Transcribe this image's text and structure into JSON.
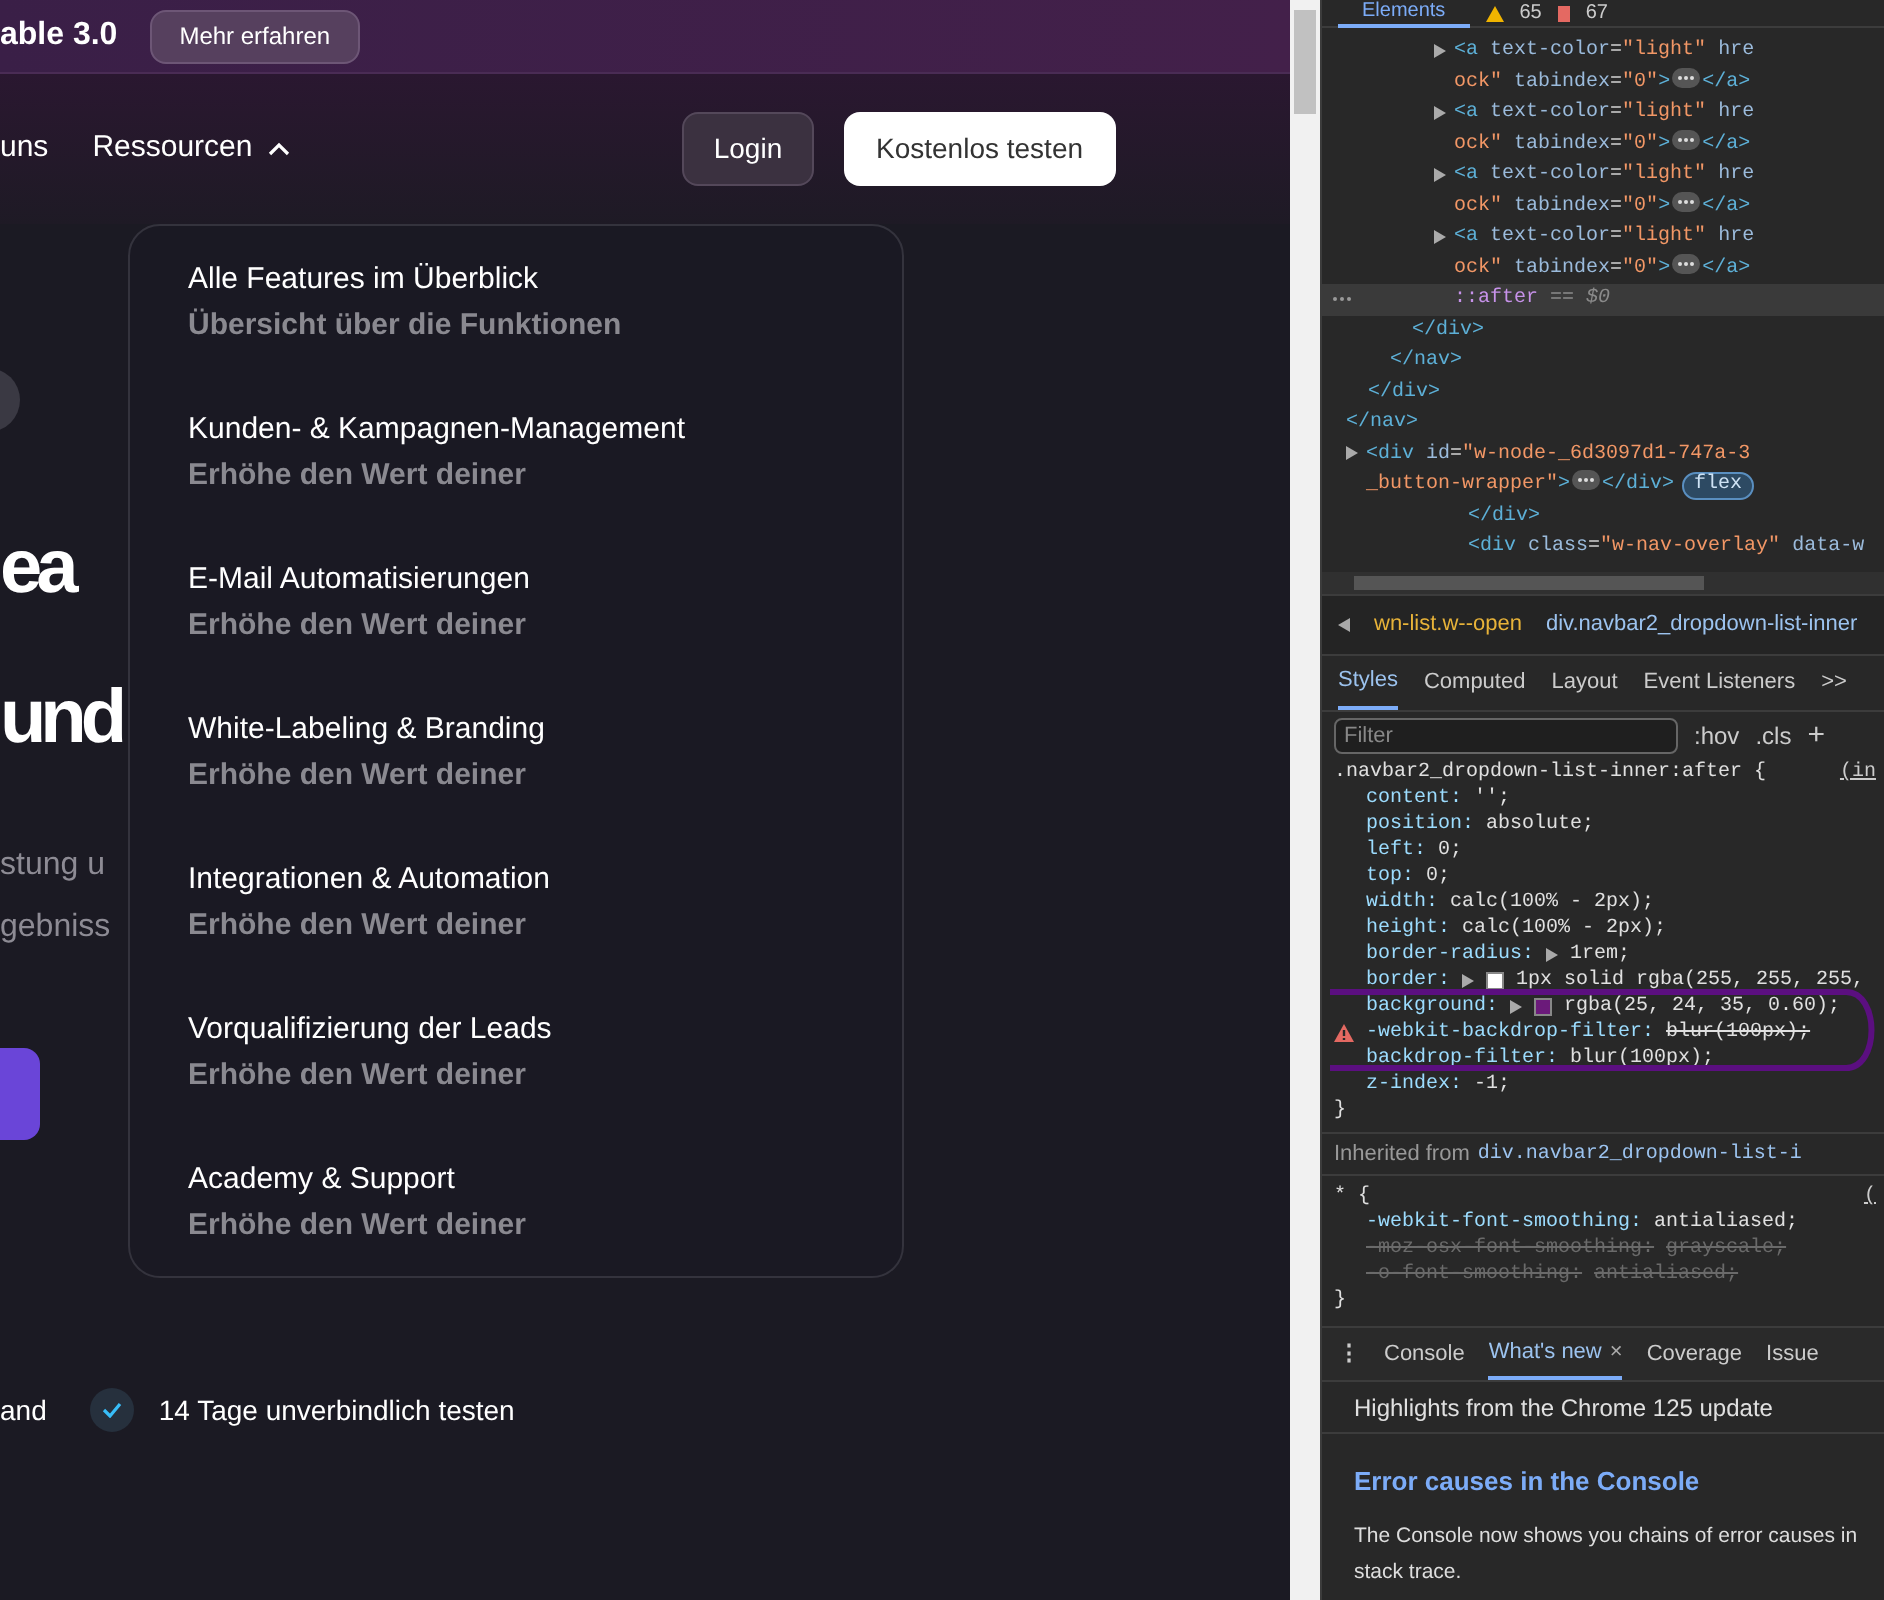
{
  "site": {
    "banner": {
      "title": "able 3.0",
      "button": "Mehr erfahren"
    },
    "nav": {
      "items": [
        {
          "label": "uns",
          "has_caret": false
        },
        {
          "label": "Ressourcen",
          "has_caret": true,
          "expanded": true
        }
      ],
      "login": "Login",
      "cta": "Kostenlos testen"
    },
    "dropdown": [
      {
        "title": "Alle Features im Überblick",
        "subtitle": "Übersicht über die Funktionen"
      },
      {
        "title": "Kunden- & Kampagnen-Management",
        "subtitle": "Erhöhe den Wert deiner"
      },
      {
        "title": "E-Mail Automatisierungen",
        "subtitle": "Erhöhe den Wert deiner"
      },
      {
        "title": "White-Labeling & Branding",
        "subtitle": "Erhöhe den Wert deiner"
      },
      {
        "title": "Integrationen & Automation",
        "subtitle": "Erhöhe den Wert deiner"
      },
      {
        "title": "Vorqualifizierung der Leads",
        "subtitle": "Erhöhe den Wert deiner"
      },
      {
        "title": "Academy & Support",
        "subtitle": "Erhöhe den Wert deiner"
      }
    ],
    "hero": {
      "headline": [
        "ea",
        "und"
      ],
      "sub": [
        "stung u",
        "gebniss"
      ]
    },
    "features": [
      {
        "label": "and",
        "checked": false
      },
      {
        "label": "14 Tage unverbindlich testen",
        "checked": true
      }
    ]
  },
  "devtools": {
    "toolbar": {
      "tabs": [
        {
          "label": "Elements",
          "selected": true
        }
      ],
      "warnings": "65",
      "issues": "67"
    },
    "tree": [
      {
        "close": "</nav>",
        "children": [
          {
            "close": "</div>",
            "children": [
              {
                "close": "</nav>",
                "children": [
                  {
                    "close": "</div>",
                    "children": [
                      {
                        "expandable": true,
                        "selected": false,
                        "lines": [
                          [
                            {
                              "kind": "tag",
                              "t": "<a "
                            },
                            {
                              "kind": "attr",
                              "t": "text-color"
                            },
                            {
                              "kind": "p",
                              "t": "="
                            },
                            {
                              "kind": "val",
                              "t": "\"light\""
                            },
                            {
                              "kind": "attr",
                              "t": " hre"
                            }
                          ],
                          [
                            {
                              "kind": "val",
                              "t": "ock\""
                            },
                            {
                              "kind": "attr",
                              "t": " tabindex"
                            },
                            {
                              "kind": "p",
                              "t": "="
                            },
                            {
                              "kind": "val",
                              "t": "\"0\""
                            },
                            {
                              "kind": "tag",
                              "t": ">"
                            },
                            {
                              "kind": "dots"
                            },
                            {
                              "kind": "tag",
                              "t": "</a>"
                            }
                          ]
                        ]
                      },
                      {
                        "expandable": true,
                        "selected": false,
                        "lines": [
                          [
                            {
                              "kind": "tag",
                              "t": "<a "
                            },
                            {
                              "kind": "attr",
                              "t": "text-color"
                            },
                            {
                              "kind": "p",
                              "t": "="
                            },
                            {
                              "kind": "val",
                              "t": "\"light\""
                            },
                            {
                              "kind": "attr",
                              "t": " hre"
                            }
                          ],
                          [
                            {
                              "kind": "val",
                              "t": "ock\""
                            },
                            {
                              "kind": "attr",
                              "t": " tabindex"
                            },
                            {
                              "kind": "p",
                              "t": "="
                            },
                            {
                              "kind": "val",
                              "t": "\"0\""
                            },
                            {
                              "kind": "tag",
                              "t": ">"
                            },
                            {
                              "kind": "dots"
                            },
                            {
                              "kind": "tag",
                              "t": "</a>"
                            }
                          ]
                        ]
                      },
                      {
                        "expandable": true,
                        "selected": false,
                        "lines": [
                          [
                            {
                              "kind": "tag",
                              "t": "<a "
                            },
                            {
                              "kind": "attr",
                              "t": "text-color"
                            },
                            {
                              "kind": "p",
                              "t": "="
                            },
                            {
                              "kind": "val",
                              "t": "\"light\""
                            },
                            {
                              "kind": "attr",
                              "t": " hre"
                            }
                          ],
                          [
                            {
                              "kind": "val",
                              "t": "ock\""
                            },
                            {
                              "kind": "attr",
                              "t": " tabindex"
                            },
                            {
                              "kind": "p",
                              "t": "="
                            },
                            {
                              "kind": "val",
                              "t": "\"0\""
                            },
                            {
                              "kind": "tag",
                              "t": ">"
                            },
                            {
                              "kind": "dots"
                            },
                            {
                              "kind": "tag",
                              "t": "</a>"
                            }
                          ]
                        ]
                      },
                      {
                        "expandable": true,
                        "selected": false,
                        "lines": [
                          [
                            {
                              "kind": "tag",
                              "t": "<a "
                            },
                            {
                              "kind": "attr",
                              "t": "text-color"
                            },
                            {
                              "kind": "p",
                              "t": "="
                            },
                            {
                              "kind": "val",
                              "t": "\"light\""
                            },
                            {
                              "kind": "attr",
                              "t": " hre"
                            }
                          ],
                          [
                            {
                              "kind": "val",
                              "t": "ock\""
                            },
                            {
                              "kind": "attr",
                              "t": " tabindex"
                            },
                            {
                              "kind": "p",
                              "t": "="
                            },
                            {
                              "kind": "val",
                              "t": "\"0\""
                            },
                            {
                              "kind": "tag",
                              "t": ">"
                            },
                            {
                              "kind": "dots"
                            },
                            {
                              "kind": "tag",
                              "t": "</a>"
                            }
                          ]
                        ]
                      },
                      {
                        "expandable": false,
                        "selected": true,
                        "lines": [
                          [
                            {
                              "kind": "pseudo",
                              "t": "::after"
                            },
                            {
                              "kind": "eq",
                              "t": " == $0"
                            }
                          ]
                        ]
                      }
                    ]
                  }
                ]
              }
            ]
          }
        ]
      },
      {
        "expandable": true,
        "selected": false,
        "lines": [
          [
            {
              "kind": "tag",
              "t": "<div "
            },
            {
              "kind": "attr",
              "t": "id"
            },
            {
              "kind": "p",
              "t": "="
            },
            {
              "kind": "val",
              "t": "\"w-node-_6d3097d1-747a-3"
            }
          ],
          [
            {
              "kind": "val",
              "t": "_button-wrapper\""
            },
            {
              "kind": "tag",
              "t": ">"
            },
            {
              "kind": "dots"
            },
            {
              "kind": "tag",
              "t": "</div>"
            },
            {
              "kind": "badge",
              "t": "flex"
            }
          ]
        ]
      }
    ],
    "after_tree": [
      {
        "kind": "tag",
        "t": "</div>"
      }
    ],
    "last_line": [
      {
        "kind": "tag",
        "t": "<div "
      },
      {
        "kind": "attr",
        "t": "class"
      },
      {
        "kind": "p",
        "t": "="
      },
      {
        "kind": "val",
        "t": "\"w-nav-overlay\""
      },
      {
        "kind": "attr",
        "t": " data-w"
      }
    ],
    "breadcrumbs": [
      {
        "label": "wn-list.w--open",
        "selected": false
      },
      {
        "label": "div.navbar2_dropdown-list-inner",
        "selected": true
      }
    ],
    "side_tabs": [
      {
        "label": "Styles",
        "selected": true
      },
      {
        "label": "Computed",
        "selected": false
      },
      {
        "label": "Layout",
        "selected": false
      },
      {
        "label": "Event Listeners",
        "selected": false
      }
    ],
    "more": ">>",
    "filter": {
      "placeholder": "Filter"
    },
    "hov": ":hov",
    "cls": ".cls",
    "plus": "+",
    "rule": {
      "selector": ".navbar2_dropdown-list-inner:after {",
      "source": "(in",
      "close": "}",
      "props": [
        {
          "name": "content:",
          "value": "'';",
          "invalid": false,
          "overridden": false,
          "arrow": false
        },
        {
          "name": "position:",
          "value": "absolute;",
          "invalid": false,
          "overridden": false,
          "arrow": false
        },
        {
          "name": "left:",
          "value": "0;",
          "invalid": false,
          "overridden": false,
          "arrow": false
        },
        {
          "name": "top:",
          "value": "0;",
          "invalid": false,
          "overridden": false,
          "arrow": false
        },
        {
          "name": "width:",
          "value": "calc(100% - 2px);",
          "invalid": false,
          "overridden": false,
          "arrow": false
        },
        {
          "name": "height:",
          "value": "calc(100% - 2px);",
          "invalid": false,
          "overridden": false,
          "arrow": false
        },
        {
          "name": "border-radius:",
          "value": "1rem;",
          "invalid": false,
          "overridden": false,
          "arrow": true
        },
        {
          "name": "border:",
          "value": "1px solid",
          "invalid": false,
          "overridden": false,
          "arrow": true,
          "color": "#ffffff",
          "after": "rgba(255, 255, 255,"
        },
        {
          "name": "background:",
          "invalid": false,
          "overridden": false,
          "arrow": true,
          "color": "#6b1a7a",
          "after": "rgba(25, 24, 35, 0.60);"
        },
        {
          "name": "-webkit-backdrop-filter:",
          "value": "blur(100px);",
          "invalid": true,
          "overridden": false,
          "arrow": false
        },
        {
          "name": "backdrop-filter:",
          "value": "blur(100px);",
          "invalid": false,
          "overridden": false,
          "arrow": false
        },
        {
          "name": "z-index:",
          "value": "-1;",
          "invalid": false,
          "overridden": false,
          "arrow": false
        }
      ]
    },
    "inherited": {
      "label": "Inherited from",
      "source": "div.navbar2_dropdown-list-i"
    },
    "rule2": {
      "selector": "* {",
      "source": "(",
      "close": "}",
      "props": [
        {
          "name": "-webkit-font-smoothing:",
          "value": "antialiased;",
          "invalid": false,
          "overridden": false,
          "arrow": false
        },
        {
          "name": "-moz-osx-font-smoothing:",
          "value": "grayscale;",
          "invalid": false,
          "overridden": true,
          "arrow": false
        },
        {
          "name": "-o-font-smoothing:",
          "value": "antialiased;",
          "invalid": false,
          "overridden": true,
          "arrow": false
        }
      ]
    },
    "drawer": {
      "menu": "⋮",
      "tabs": [
        {
          "label": "Console",
          "selected": false,
          "closable": false
        },
        {
          "label": "What's new",
          "selected": true,
          "closable": true
        },
        {
          "label": "Coverage",
          "selected": false,
          "closable": false
        },
        {
          "label": "Issue",
          "selected": false,
          "closable": false
        }
      ],
      "close": "×",
      "header": "Highlights from the Chrome 125 update",
      "heading": "Error causes in the Console",
      "body": [
        "The Console now shows you chains of error causes in",
        "stack trace."
      ]
    }
  }
}
